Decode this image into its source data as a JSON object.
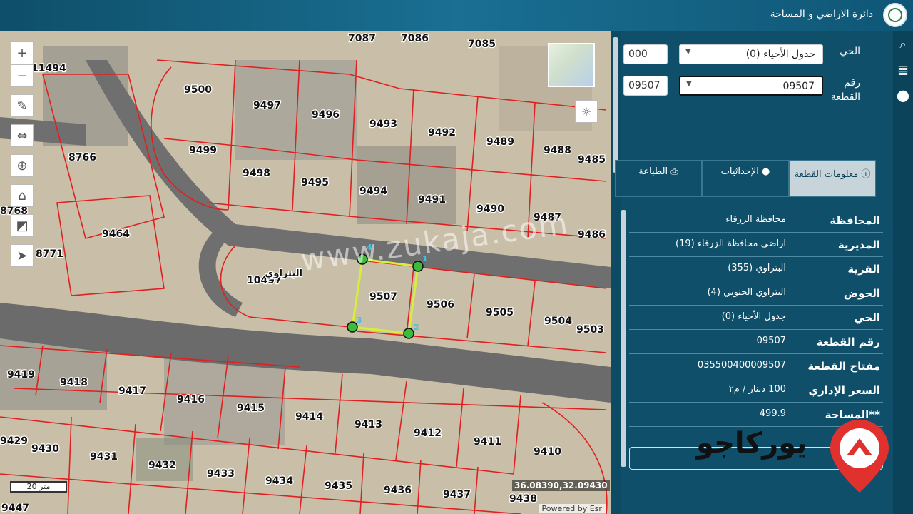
{
  "header": {
    "title": "دائرة الاراضي و المساحة"
  },
  "map": {
    "coords": "36.08390,32.09430",
    "scale": "20 متر",
    "powered_by": "Powered by Esri",
    "area_label": "البتراوي",
    "parcel_labels": [
      "7087",
      "7086",
      "7085",
      "11494",
      "9500",
      "9497",
      "9496",
      "9493",
      "9492",
      "9489",
      "9488",
      "9485",
      "8766",
      "9499",
      "9498",
      "9495",
      "9494",
      "9491",
      "9490",
      "9487",
      "9464",
      "9486",
      "8768",
      "8771",
      "10497",
      "9507",
      "9506",
      "9505",
      "9504",
      "9503",
      "9419",
      "9418",
      "9417",
      "9416",
      "9415",
      "9414",
      "9413",
      "9412",
      "9411",
      "9410",
      "9429",
      "9430",
      "9431",
      "9432",
      "9433",
      "9434",
      "9435",
      "9436",
      "9437",
      "9438",
      "9447"
    ],
    "vertex_labels": [
      "1",
      "2",
      "3",
      "4"
    ]
  },
  "panel": {
    "hay_label": "الحي",
    "hay_code": "000",
    "hay_value": "جدول الأحياء (0)",
    "parcel_label": "رقم القطعة",
    "parcel_code": "09507",
    "parcel_value": "09507",
    "tabs": [
      {
        "label": "معلومات القطعة",
        "icon": "info-icon"
      },
      {
        "label": "الإحداثيات",
        "icon": "pin-icon"
      },
      {
        "label": "الطباعة",
        "icon": "print-icon"
      }
    ],
    "info": [
      {
        "k": "المحافظة",
        "v": "محافظة الزرقاء"
      },
      {
        "k": "المديرية",
        "v": "اراضي محافظة الزرقاء (19)"
      },
      {
        "k": "القرية",
        "v": "البتراوي (355)"
      },
      {
        "k": "الحوض",
        "v": "البتراوي الجنوبي (4)"
      },
      {
        "k": "الحي",
        "v": "جدول الأحياء (0)"
      },
      {
        "k": "رقم القطعة",
        "v": "09507"
      },
      {
        "k": "مفتاح القطعة",
        "v": "035500400009507"
      },
      {
        "k": "السعر الإداري",
        "v": "100 دينار / م٢"
      },
      {
        "k": "**المساحة",
        "v": "499.9"
      }
    ]
  },
  "watermark": {
    "url": "www.zukaja.com",
    "brand": "يوركاجو"
  },
  "colors": {
    "header": "#1a6f92",
    "panel": "#0f4f6a",
    "parcel_line": "#e02020",
    "selected": "#d8ef3a"
  }
}
